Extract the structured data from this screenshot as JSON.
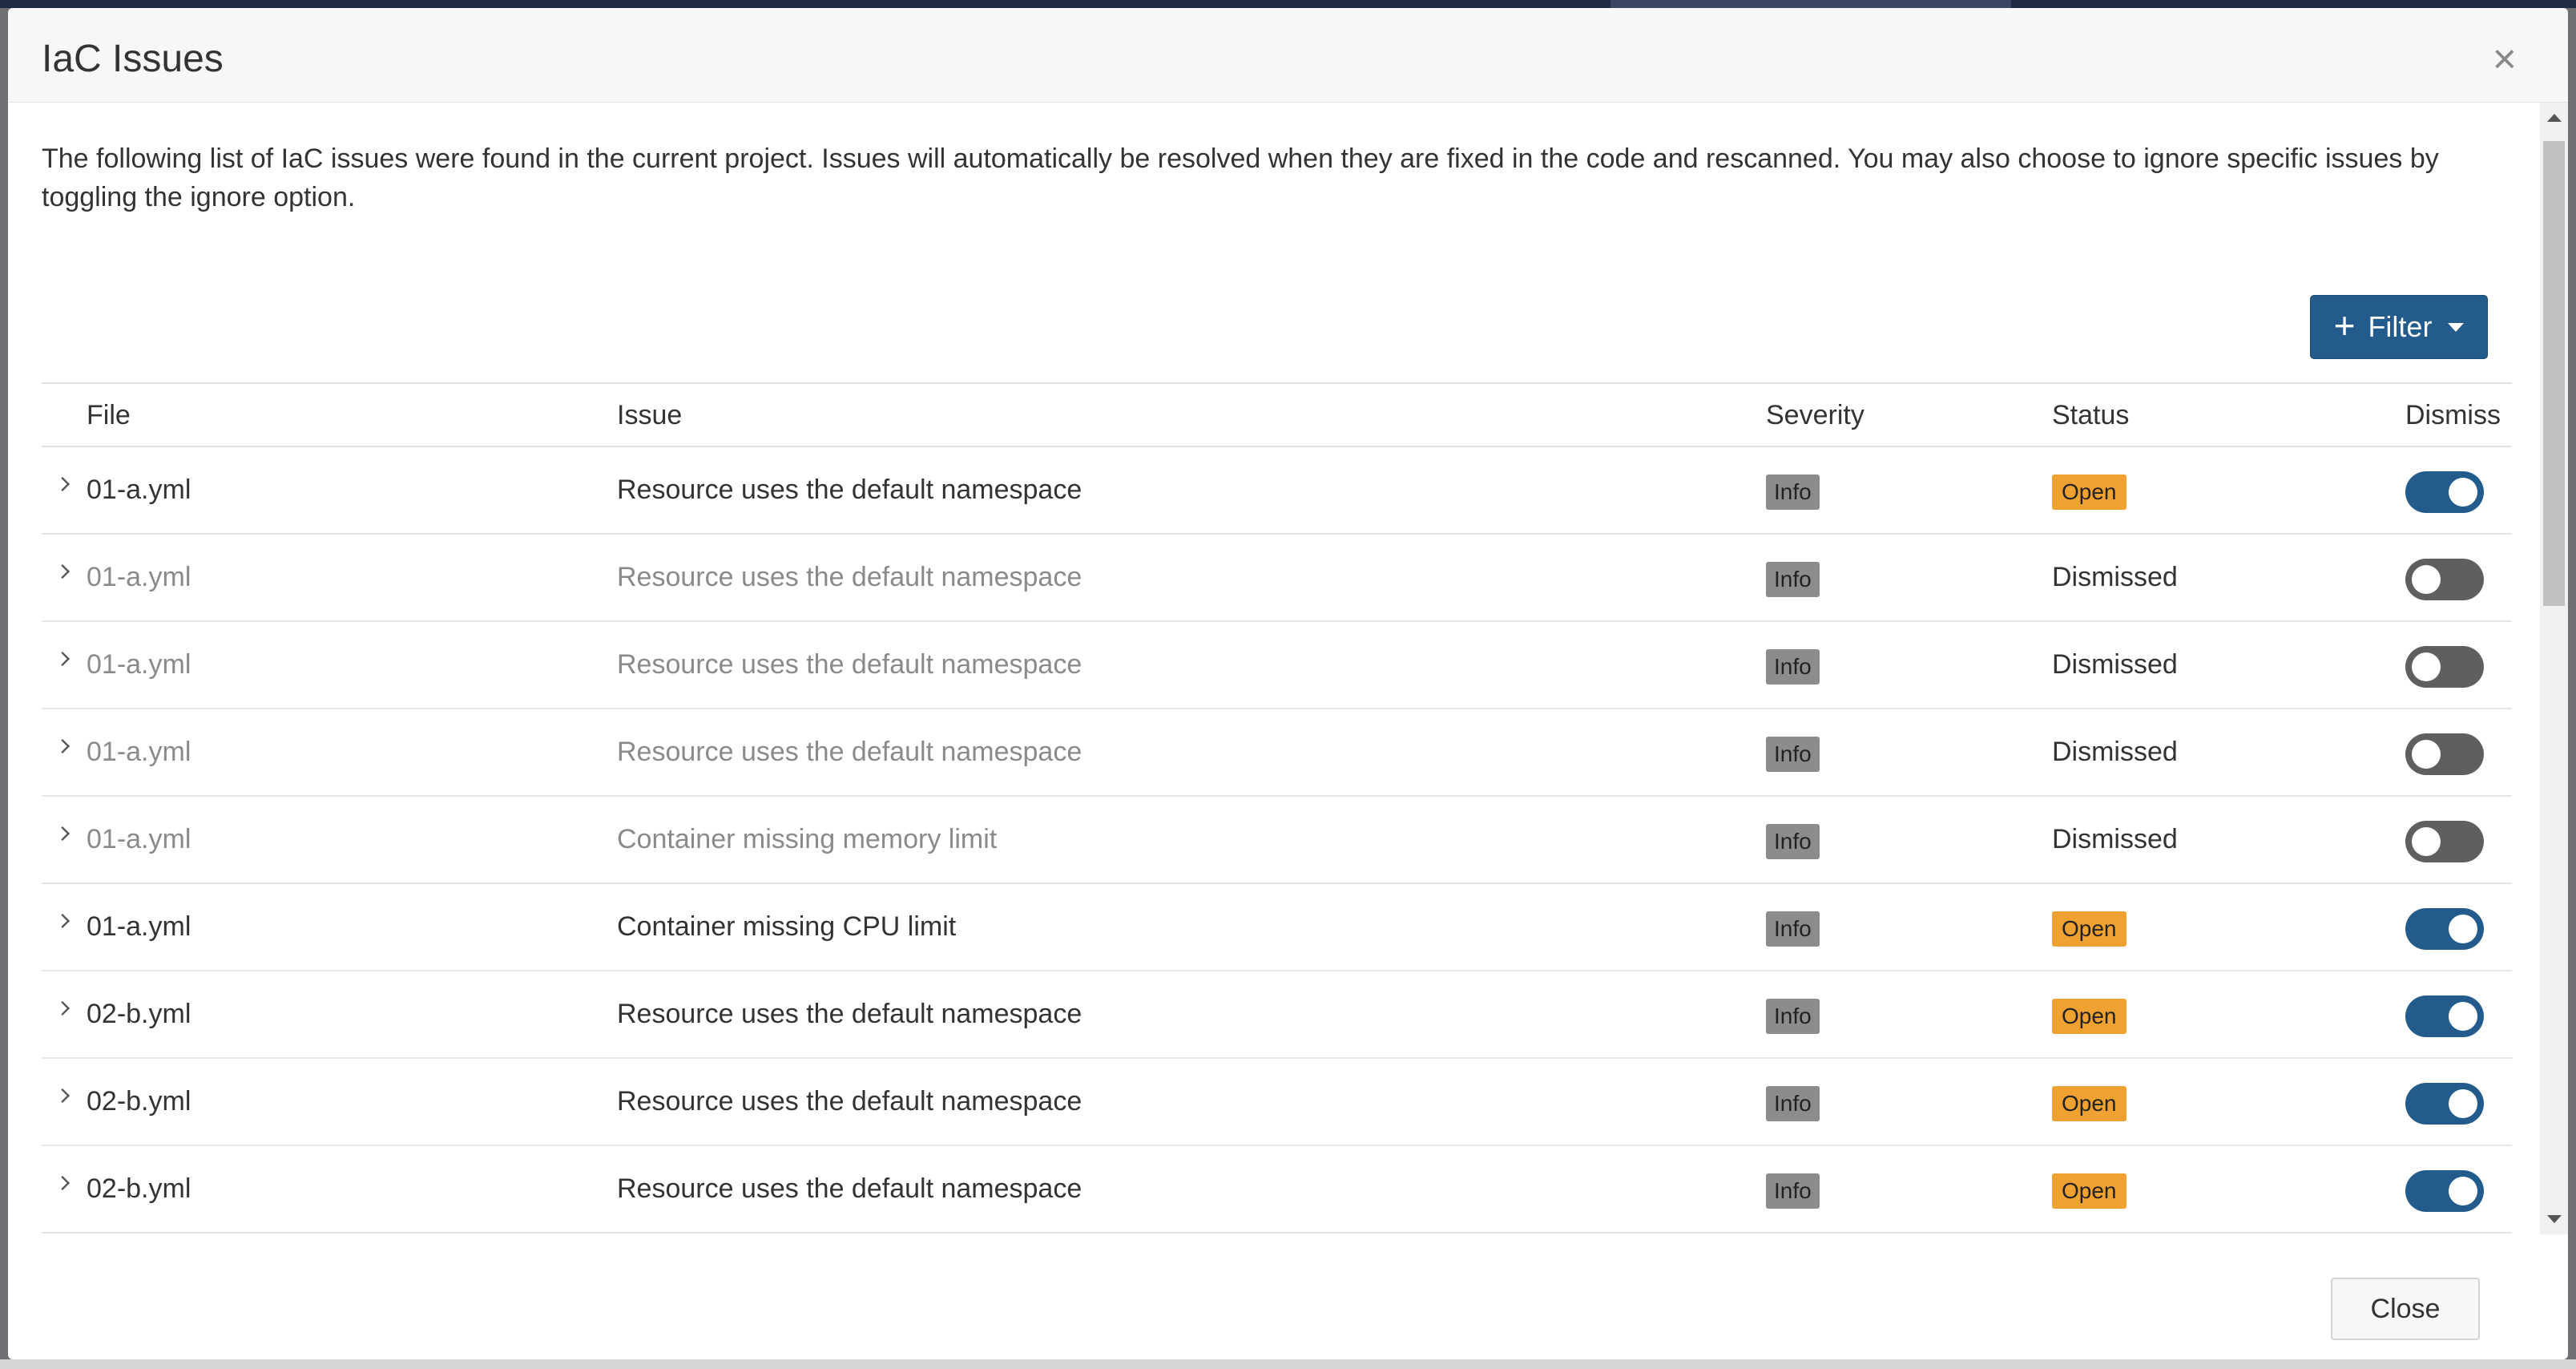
{
  "modal": {
    "title": "IaC Issues",
    "close_icon": "close-icon",
    "description": "The following list of IaC issues were found in the current project. Issues will automatically be resolved when they are fixed in the code and rescanned. You may also choose to ignore specific issues by toggling the ignore option.",
    "filter_label": "Filter",
    "close_label": "Close"
  },
  "table": {
    "headers": {
      "file": "File",
      "issue": "Issue",
      "severity": "Severity",
      "status": "Status",
      "dismiss": "Dismiss"
    },
    "rows": [
      {
        "file": "01-a.yml",
        "issue": "Resource uses the default namespace",
        "severity": "Info",
        "status": "Open",
        "dismissed": false
      },
      {
        "file": "01-a.yml",
        "issue": "Resource uses the default namespace",
        "severity": "Info",
        "status": "Dismissed",
        "dismissed": true
      },
      {
        "file": "01-a.yml",
        "issue": "Resource uses the default namespace",
        "severity": "Info",
        "status": "Dismissed",
        "dismissed": true
      },
      {
        "file": "01-a.yml",
        "issue": "Resource uses the default namespace",
        "severity": "Info",
        "status": "Dismissed",
        "dismissed": true
      },
      {
        "file": "01-a.yml",
        "issue": "Container missing memory limit",
        "severity": "Info",
        "status": "Dismissed",
        "dismissed": true
      },
      {
        "file": "01-a.yml",
        "issue": "Container missing CPU limit",
        "severity": "Info",
        "status": "Open",
        "dismissed": false
      },
      {
        "file": "02-b.yml",
        "issue": "Resource uses the default namespace",
        "severity": "Info",
        "status": "Open",
        "dismissed": false
      },
      {
        "file": "02-b.yml",
        "issue": "Resource uses the default namespace",
        "severity": "Info",
        "status": "Open",
        "dismissed": false
      },
      {
        "file": "02-b.yml",
        "issue": "Resource uses the default namespace",
        "severity": "Info",
        "status": "Open",
        "dismissed": false
      }
    ]
  },
  "colors": {
    "primary": "#235b8d",
    "open_badge": "#efa232",
    "info_badge": "#8c8c8c",
    "toggle_off": "#5f5f5f"
  }
}
